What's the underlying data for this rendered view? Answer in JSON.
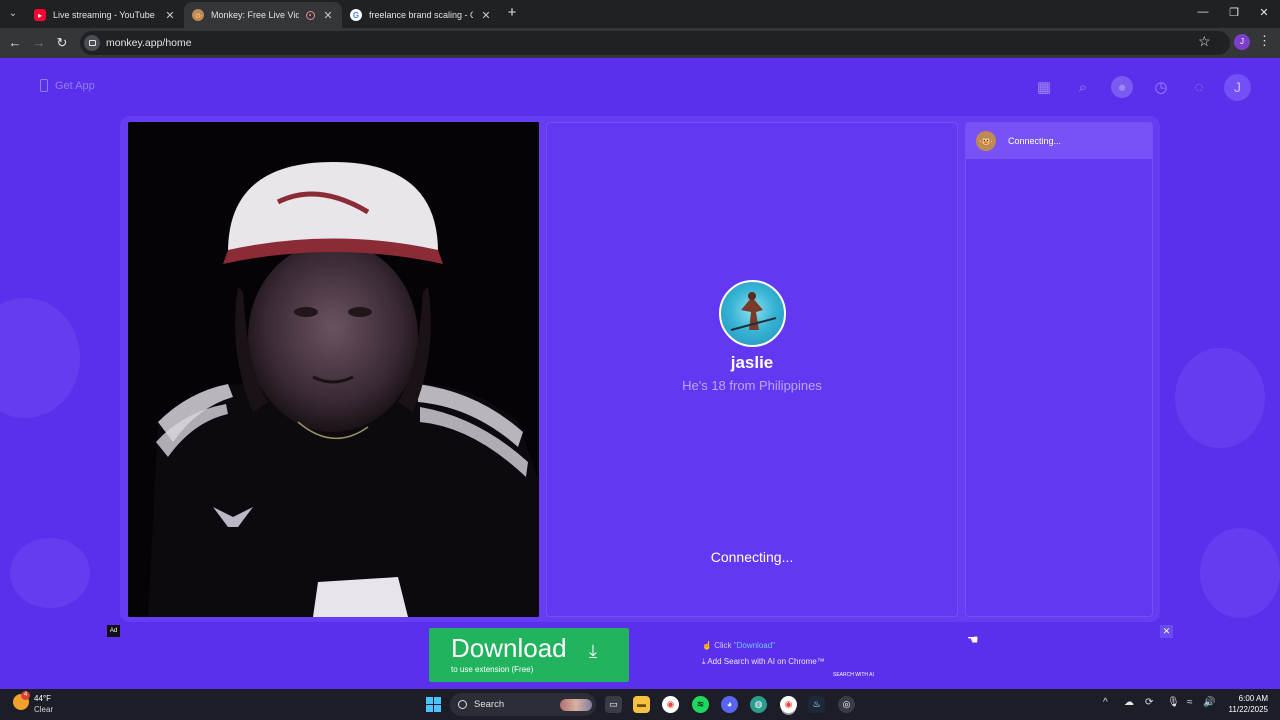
{
  "browser": {
    "tabs": [
      {
        "title": "Live streaming - YouTube Studio",
        "active": false
      },
      {
        "title": "Monkey: Free Live Video Chat",
        "active": true
      },
      {
        "title": "freelance brand scaling - Google Search",
        "active": false
      }
    ],
    "url": "monkey.app/home",
    "profile_initial": "J"
  },
  "header": {
    "get_app_label": "Get App",
    "user_initial": "J"
  },
  "match": {
    "name": "jaslie",
    "info": "He's 18 from Philippines",
    "status": "Connecting..."
  },
  "chat": {
    "status": "Connecting..."
  },
  "ad": {
    "badge": "Ad",
    "download_label": "Download",
    "download_sub": "to use extension (Free)",
    "line1_prefix": "Click ",
    "line1_link": "\"Download\"",
    "line2": "Add Search with AI on Chrome™",
    "logo_text": "SEARCH WITH AI"
  },
  "taskbar": {
    "weather_badge": "4",
    "temperature": "44°F",
    "condition": "Clear",
    "search_placeholder": "Search",
    "time": "6:00 AM",
    "date": "11/22/2025"
  },
  "colors": {
    "page_bg": "#5b30ec",
    "panel_bg": "#6238f3",
    "download_green": "#22b35e"
  }
}
